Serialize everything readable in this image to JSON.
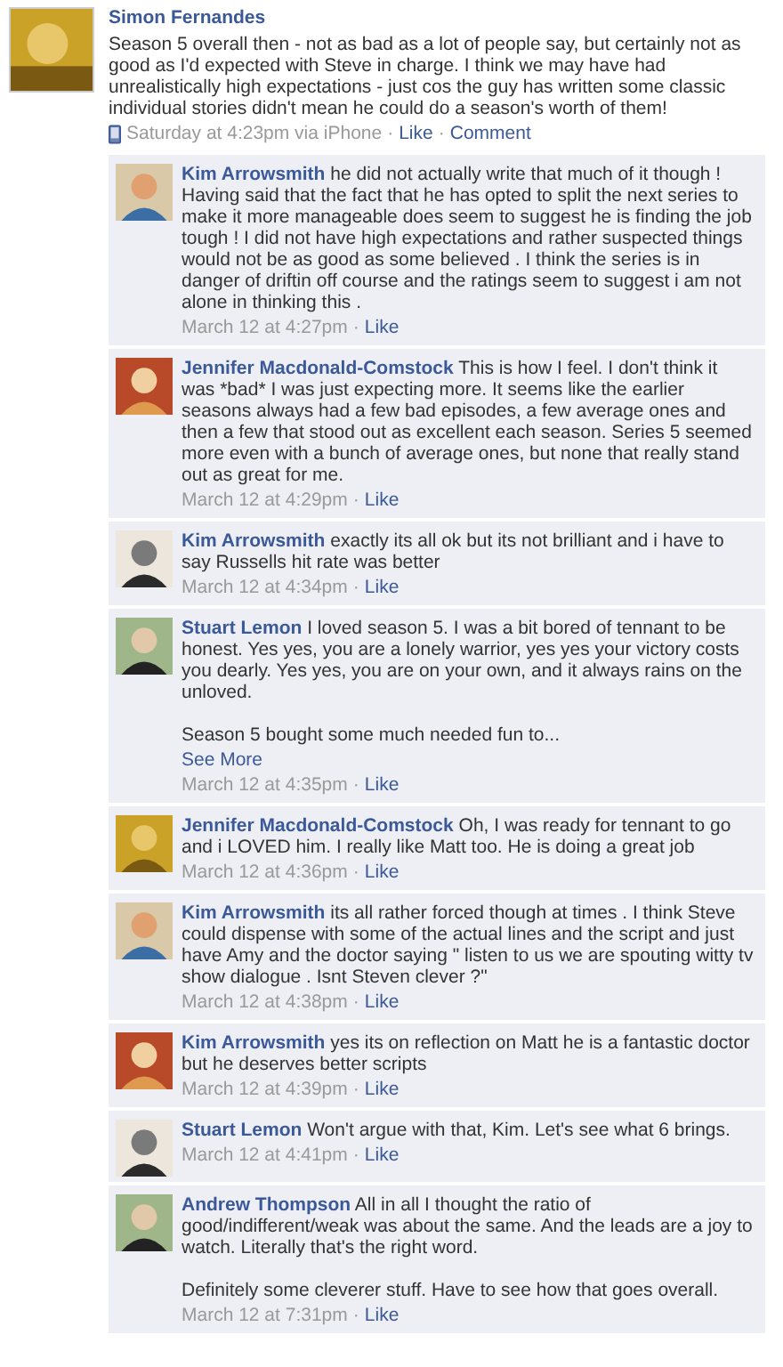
{
  "post": {
    "author": "Simon Fernandes",
    "paragraphs": [
      "Season 5 overall then - not as bad as a lot of people say, but certainly not as good as I'd expected with Steve in charge. I think we may have had unrealistically high expectations - just cos the guy has written some classic individual stories didn't mean he could do a season's worth of them!"
    ],
    "time": "Saturday at 4:23pm via iPhone",
    "links": [
      "Like",
      "Comment"
    ]
  },
  "separator": "·",
  "comments": [
    {
      "author": "Kim Arrowsmith",
      "paragraphs": [
        "he did not actually write that much of it though ! Having said that the fact that he has opted to split the next series to make it more manageable does seem to suggest he is finding the job tough ! I did not have high expectations and rather suspected things would not be as good as some believed . I think the series is in danger of driftin off course and the ratings seem to suggest i am not alone in thinking this ."
      ],
      "time": "March 12 at 4:27pm",
      "links": [
        "Like"
      ]
    },
    {
      "author": "Jennifer Macdonald-Comstock",
      "paragraphs": [
        "This is how I feel. I don't think it was *bad* I was just expecting more. It seems like the earlier seasons always had a few bad episodes, a few average ones and then a few that stood out as excellent each season. Series 5 seemed more even with a bunch of average ones, but none that really stand out as great for me."
      ],
      "time": "March 12 at 4:29pm",
      "links": [
        "Like"
      ]
    },
    {
      "author": "Kim Arrowsmith",
      "paragraphs": [
        "exactly its all ok but its not brilliant and i have to say Russells hit rate was better"
      ],
      "time": "March 12 at 4:34pm",
      "links": [
        "Like"
      ]
    },
    {
      "author": "Stuart Lemon",
      "paragraphs": [
        "I loved season 5. I was a bit bored of tennant to be honest. Yes yes, you are a lonely warrior, yes yes your victory costs you dearly. Yes yes, you are on your own, and it always rains on the unloved.",
        "Season 5 bought some much needed fun to..."
      ],
      "see_more": "See More",
      "time": "March 12 at 4:35pm",
      "links": [
        "Like"
      ]
    },
    {
      "author": "Jennifer Macdonald-Comstock",
      "paragraphs": [
        "Oh, I was ready for tennant to go and i LOVED him. I really like Matt too. He is doing a great job"
      ],
      "time": "March 12 at 4:36pm",
      "links": [
        "Like"
      ]
    },
    {
      "author": "Kim Arrowsmith",
      "paragraphs": [
        "its all rather forced though at times . I think Steve could dispense with some of the actual lines and the script and just have Amy and the doctor saying \" listen to us we are spouting witty tv show dialogue . Isnt Steven clever ?\""
      ],
      "time": "March 12 at 4:38pm",
      "links": [
        "Like"
      ]
    },
    {
      "author": "Kim Arrowsmith",
      "paragraphs": [
        "yes its on reflection on Matt he is a fantastic doctor but he deserves better scripts"
      ],
      "time": "March 12 at 4:39pm",
      "links": [
        "Like"
      ]
    },
    {
      "author": "Stuart Lemon",
      "paragraphs": [
        "Won't argue with that, Kim. Let's see what 6 brings."
      ],
      "time": "March 12 at 4:41pm",
      "links": [
        "Like"
      ]
    },
    {
      "author": "Andrew Thompson",
      "paragraphs": [
        "All in all I thought the ratio of good/indifferent/weak was about the same. And the leads are a joy to watch. Literally that's the right word.",
        "Definitely some cleverer stuff. Have to see how that goes overall."
      ],
      "time": "March 12 at 7:31pm",
      "links": [
        "Like"
      ]
    }
  ]
}
